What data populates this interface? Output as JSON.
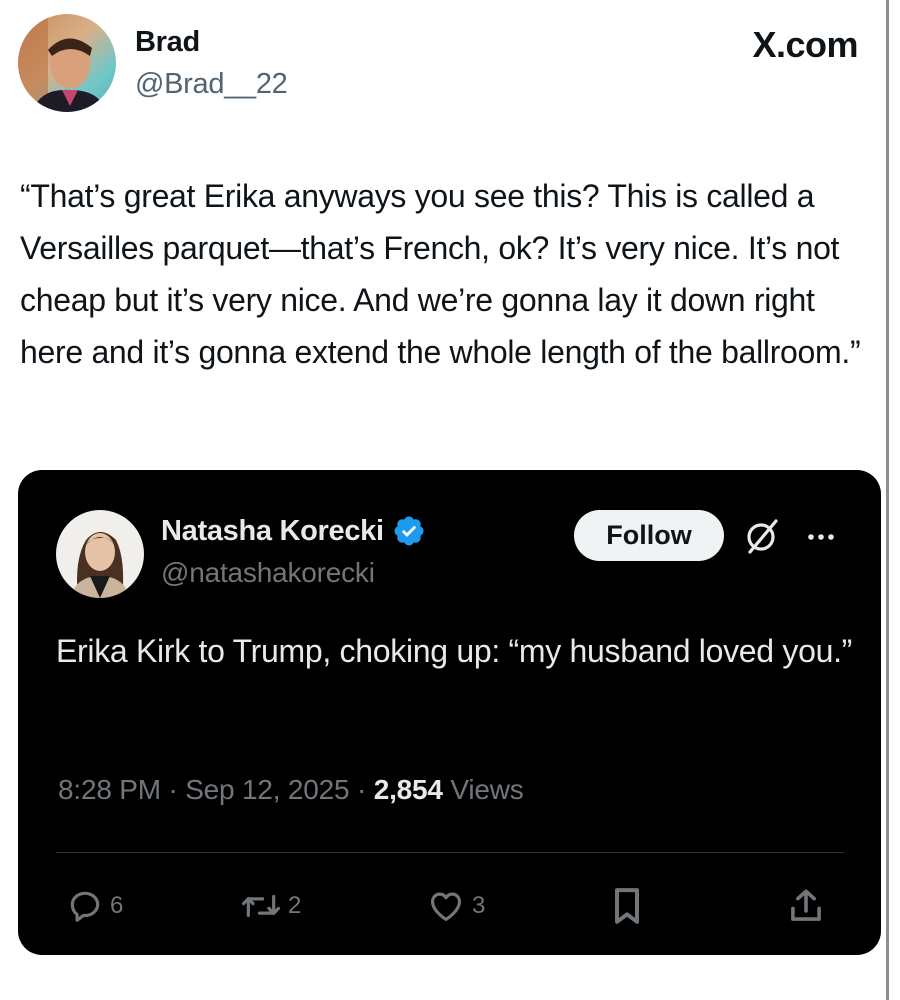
{
  "post": {
    "author_name": "Brad",
    "author_handle": "@Brad__22",
    "brand": "X.com",
    "text": "“That’s great Erika anyways you see this? This is called a Versailles parquet—that’s French, ok? It’s very nice. It’s not cheap but it’s very nice. And we’re gonna lay it down right here and it’s gonna extend the whole length of the ballroom.”"
  },
  "quoted": {
    "author_name": "Natasha Korecki",
    "author_handle": "@natashakorecki",
    "follow_label": "Follow",
    "text": "Erika Kirk to Trump, choking up: “my husband loved you.”",
    "time": "8:28 PM",
    "date": "Sep 12, 2025",
    "separator": "·",
    "views_count": "2,854",
    "views_label": "Views",
    "replies": "6",
    "retweets": "2",
    "likes": "3"
  },
  "icons": {
    "verified": "verified-badge-icon",
    "grok": "grok-icon",
    "more": "more-icon",
    "reply": "reply-icon",
    "retweet": "retweet-icon",
    "like": "heart-icon",
    "bookmark": "bookmark-icon",
    "share": "share-icon"
  },
  "colors": {
    "verified_blue": "#1d9bf0",
    "card_background": "#000000",
    "muted_text": "#71767b",
    "handle_gray": "#536471"
  }
}
